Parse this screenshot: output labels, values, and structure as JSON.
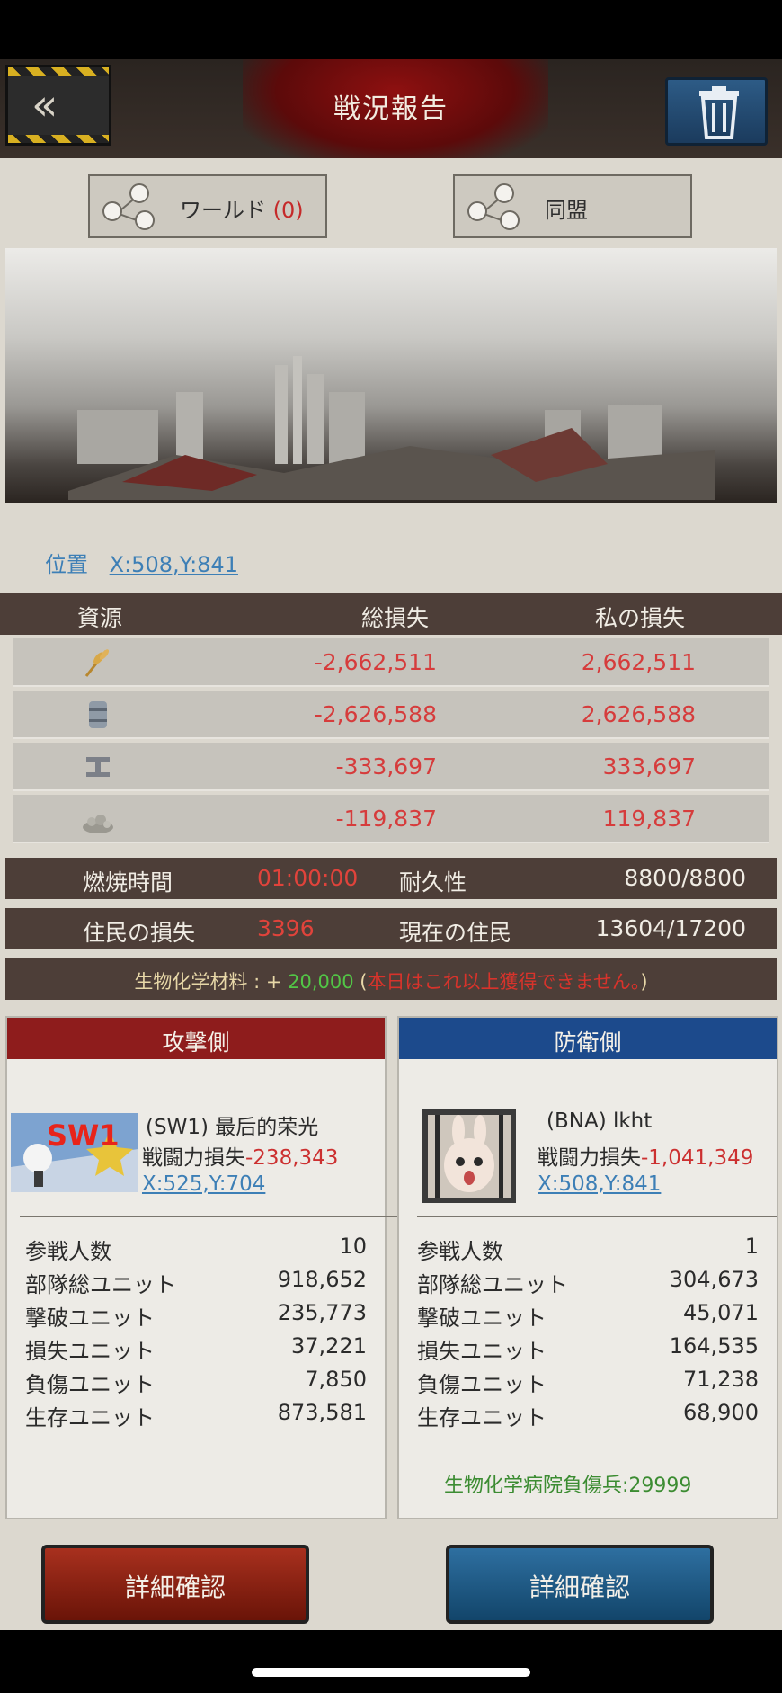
{
  "header": {
    "title": "戦況報告",
    "back_icon": "double-chevron-left-icon",
    "trash_icon": "trash-can-icon"
  },
  "tabs": [
    {
      "label": "ワールド",
      "count": "(0)",
      "icon": "share-nodes-icon"
    },
    {
      "label": "同盟",
      "icon": "share-nodes-icon"
    }
  ],
  "position": {
    "label": "位置",
    "value": "X:508,Y:841"
  },
  "resources": {
    "headers": [
      "資源",
      "総損失",
      "私の損失"
    ],
    "rows": [
      {
        "icon": "wheat-icon",
        "total": "-2,662,511",
        "mine": "2,662,511"
      },
      {
        "icon": "oil-barrel-icon",
        "total": "-2,626,588",
        "mine": "2,626,588"
      },
      {
        "icon": "steel-beam-icon",
        "total": "-333,697",
        "mine": "333,697"
      },
      {
        "icon": "ore-pile-icon",
        "total": "-119,837",
        "mine": "119,837"
      }
    ]
  },
  "stats_bars": {
    "burn_label": "燃焼時間",
    "burn_value": "01:00:00",
    "durability_label": "耐久性",
    "durability_value": "8800/8800",
    "resident_loss_label": "住民の損失",
    "resident_loss_value": "3396",
    "current_residents_label": "現在の住民",
    "current_residents_value": "13604/17200"
  },
  "bio": {
    "prefix": "生物化学材料 : + ",
    "amount": "20,000",
    "paren_open": " (",
    "note": "本日はこれ以上獲得できません。",
    "paren_close": ")"
  },
  "attacker": {
    "header": "攻撃側",
    "name": "(SW1) 最后的荣光",
    "loss_label": "戦闘力損失",
    "loss_value": "-238,343",
    "coord": "X:525,Y:704",
    "avatar_text": "SW1",
    "stats": [
      {
        "label": "参戦人数",
        "value": "10"
      },
      {
        "label": "部隊総ユニット",
        "value": "918,652"
      },
      {
        "label": "撃破ユニット",
        "value": "235,773"
      },
      {
        "label": "損失ユニット",
        "value": "37,221"
      },
      {
        "label": "負傷ユニット",
        "value": "7,850"
      },
      {
        "label": "生存ユニット",
        "value": "873,581"
      }
    ],
    "button": "詳細確認"
  },
  "defender": {
    "header": "防衛側",
    "name": "(BNA) lkht",
    "loss_label": "戦闘力損失",
    "loss_value": "-1,041,349",
    "coord": "X:508,Y:841",
    "stats": [
      {
        "label": "参戦人数",
        "value": "1"
      },
      {
        "label": "部隊総ユニット",
        "value": "304,673"
      },
      {
        "label": "撃破ユニット",
        "value": "45,071"
      },
      {
        "label": "損失ユニット",
        "value": "164,535"
      },
      {
        "label": "負傷ユニット",
        "value": "71,238"
      },
      {
        "label": "生存ユニット",
        "value": "68,900"
      }
    ],
    "hospital": "生物化学病院負傷兵:29999",
    "button": "詳細確認"
  },
  "colors": {
    "attacker": "#8e1c1c",
    "defender": "#1c4a8c",
    "loss_red": "#d63c3c",
    "link_blue": "#3d7fb6",
    "bar_brown": "#4d3e38"
  }
}
